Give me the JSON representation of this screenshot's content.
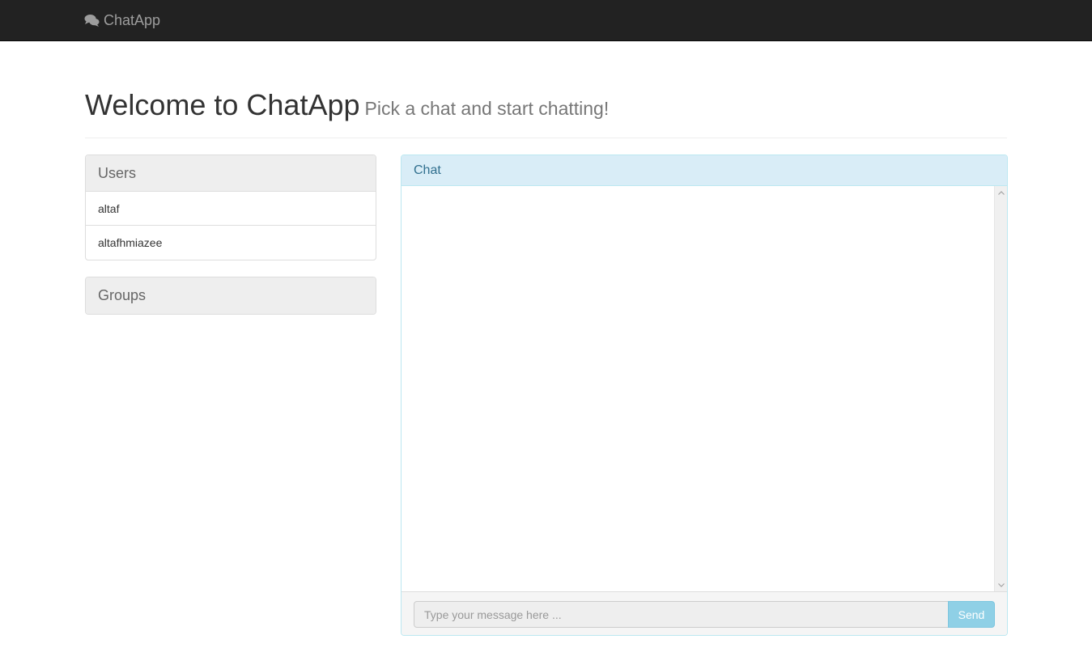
{
  "navbar": {
    "brand_icon": "comments-icon",
    "brand_text": "ChatApp"
  },
  "header": {
    "title": "Welcome to ChatApp",
    "subtitle": "Pick a chat and start chatting!"
  },
  "users": {
    "heading": "Users",
    "items": [
      {
        "label": "altaf"
      },
      {
        "label": "altafhmiazee"
      }
    ]
  },
  "groups": {
    "heading": "Groups"
  },
  "chat": {
    "heading": "Chat",
    "input": {
      "value": "",
      "placeholder": "Type your message here ..."
    },
    "send_label": "Send"
  },
  "colors": {
    "navbar_bg": "#222222",
    "chat_heading_bg": "#d9edf7",
    "chat_heading_text": "#31708f",
    "send_button_bg": "#8fd0e6"
  }
}
